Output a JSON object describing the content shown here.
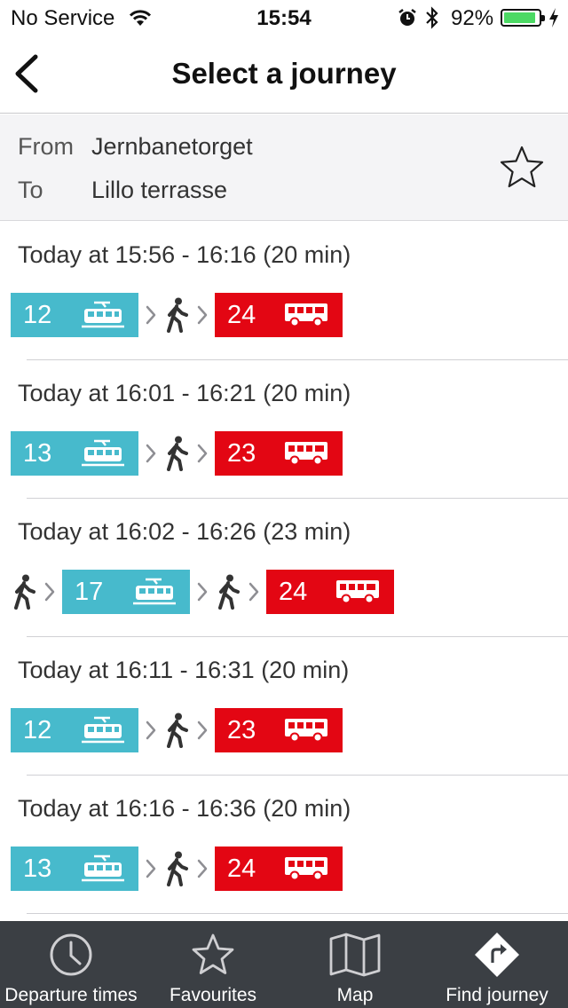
{
  "status_bar": {
    "carrier": "No Service",
    "time": "15:54",
    "battery_percent": "92%",
    "battery_level": 0.92,
    "battery_color": "#4cd964"
  },
  "nav": {
    "title": "Select a journey",
    "back_icon": "chevron-left-icon"
  },
  "route": {
    "from_label": "From",
    "from_value": "Jernbanetorget",
    "to_label": "To",
    "to_value": "Lillo terrasse",
    "favourite_icon": "star-outline-icon"
  },
  "colors": {
    "tram": "#47bacc",
    "bus": "#e30613",
    "tab_bar": "#3b3f44"
  },
  "journeys": [
    {
      "time_text": "Today at 15:56 - 16:16 (20 min)",
      "legs": [
        {
          "kind": "tram",
          "line": "12"
        },
        {
          "kind": "walk"
        },
        {
          "kind": "bus",
          "line": "24"
        }
      ]
    },
    {
      "time_text": "Today at 16:01 - 16:21 (20 min)",
      "legs": [
        {
          "kind": "tram",
          "line": "13"
        },
        {
          "kind": "walk"
        },
        {
          "kind": "bus",
          "line": "23"
        }
      ]
    },
    {
      "time_text": "Today at 16:02 - 16:26 (23 min)",
      "legs": [
        {
          "kind": "walk"
        },
        {
          "kind": "tram",
          "line": "17"
        },
        {
          "kind": "walk"
        },
        {
          "kind": "bus",
          "line": "24"
        }
      ]
    },
    {
      "time_text": "Today at 16:11 - 16:31 (20 min)",
      "legs": [
        {
          "kind": "tram",
          "line": "12"
        },
        {
          "kind": "walk"
        },
        {
          "kind": "bus",
          "line": "23"
        }
      ]
    },
    {
      "time_text": "Today at 16:16 - 16:36 (20 min)",
      "legs": [
        {
          "kind": "tram",
          "line": "13"
        },
        {
          "kind": "walk"
        },
        {
          "kind": "bus",
          "line": "24"
        }
      ]
    }
  ],
  "tabs": [
    {
      "label": "Departure times",
      "icon": "clock-icon",
      "selected": false
    },
    {
      "label": "Favourites",
      "icon": "star-icon",
      "selected": false
    },
    {
      "label": "Map",
      "icon": "map-icon",
      "selected": false
    },
    {
      "label": "Find journey",
      "icon": "directions-icon",
      "selected": true
    }
  ]
}
